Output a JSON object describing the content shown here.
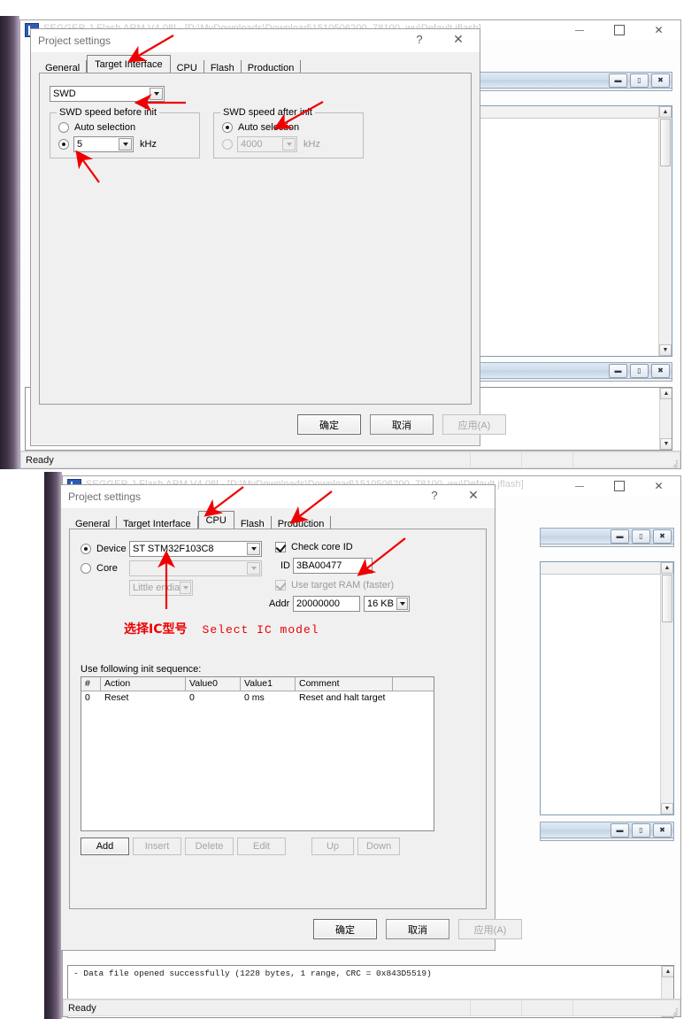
{
  "app": {
    "window_title": "SEGGER J-Flash ARM V4.08l - [D:\\MyDownloads\\Download\\1510506200_78100_wu\\Default.jflash]",
    "status_text": "Ready",
    "log_line": "- Data file opened successfully (1228 bytes, 1 range, CRC = 0x843D5519)",
    "titlebar_buttons": {
      "minimize": "–",
      "maximize": "☐",
      "close": "✕"
    },
    "mdi_buttons": {
      "minimize": "━",
      "restore": "▭",
      "close": "✖"
    }
  },
  "dialog": {
    "title": "Project settings",
    "help_label": "?",
    "close_label": "✕",
    "tabs": [
      {
        "label": "General"
      },
      {
        "label": "Target Interface"
      },
      {
        "label": "CPU"
      },
      {
        "label": "Flash"
      },
      {
        "label": "Production"
      }
    ],
    "buttons": {
      "ok": "确定",
      "cancel": "取消",
      "apply": "应用(A)"
    }
  },
  "target_interface": {
    "active_tab_index": 1,
    "interface_combo": {
      "value": "SWD"
    },
    "speed_before": {
      "caption": "SWD speed before init",
      "auto_label": "Auto selection",
      "auto_selected": false,
      "manual_selected": true,
      "value": "5",
      "unit": "kHz"
    },
    "speed_after": {
      "caption": "SWD speed after init",
      "auto_label": "Auto selection",
      "auto_selected": true,
      "manual_selected": false,
      "value": "4000",
      "unit": "kHz"
    }
  },
  "cpu": {
    "active_tab_index": 2,
    "device_label": "Device",
    "device_selected": true,
    "device_value": "ST STM32F103C8",
    "core_label": "Core",
    "core_selected": false,
    "core_value": "",
    "endian_value": "Little endian",
    "check_core_id": {
      "label": "Check core ID",
      "checked": true
    },
    "id_label": "ID",
    "id_value": "3BA00477",
    "use_target_ram": {
      "label": "Use target RAM (faster)",
      "checked": true,
      "enabled": false
    },
    "addr_label": "Addr",
    "addr_value": "20000000",
    "ram_size_value": "16 KB",
    "init_sequence_label": "Use following init sequence:",
    "table": {
      "columns": [
        "#",
        "Action",
        "Value0",
        "Value1",
        "Comment",
        ""
      ],
      "rows": [
        {
          "num": "0",
          "action": "Reset",
          "value0": "0",
          "value1": "0 ms",
          "comment": "Reset and halt target"
        }
      ]
    },
    "table_buttons": [
      {
        "label": "Add",
        "enabled": true
      },
      {
        "label": "Insert",
        "enabled": false
      },
      {
        "label": "Delete",
        "enabled": false
      },
      {
        "label": "Edit",
        "enabled": false
      },
      {
        "label": "Up",
        "enabled": false
      },
      {
        "label": "Down",
        "enabled": false
      }
    ]
  },
  "annotations": {
    "color": "#ee0000",
    "select_ic_cn": "选择IC型号",
    "select_ic_en": "Select IC model"
  }
}
